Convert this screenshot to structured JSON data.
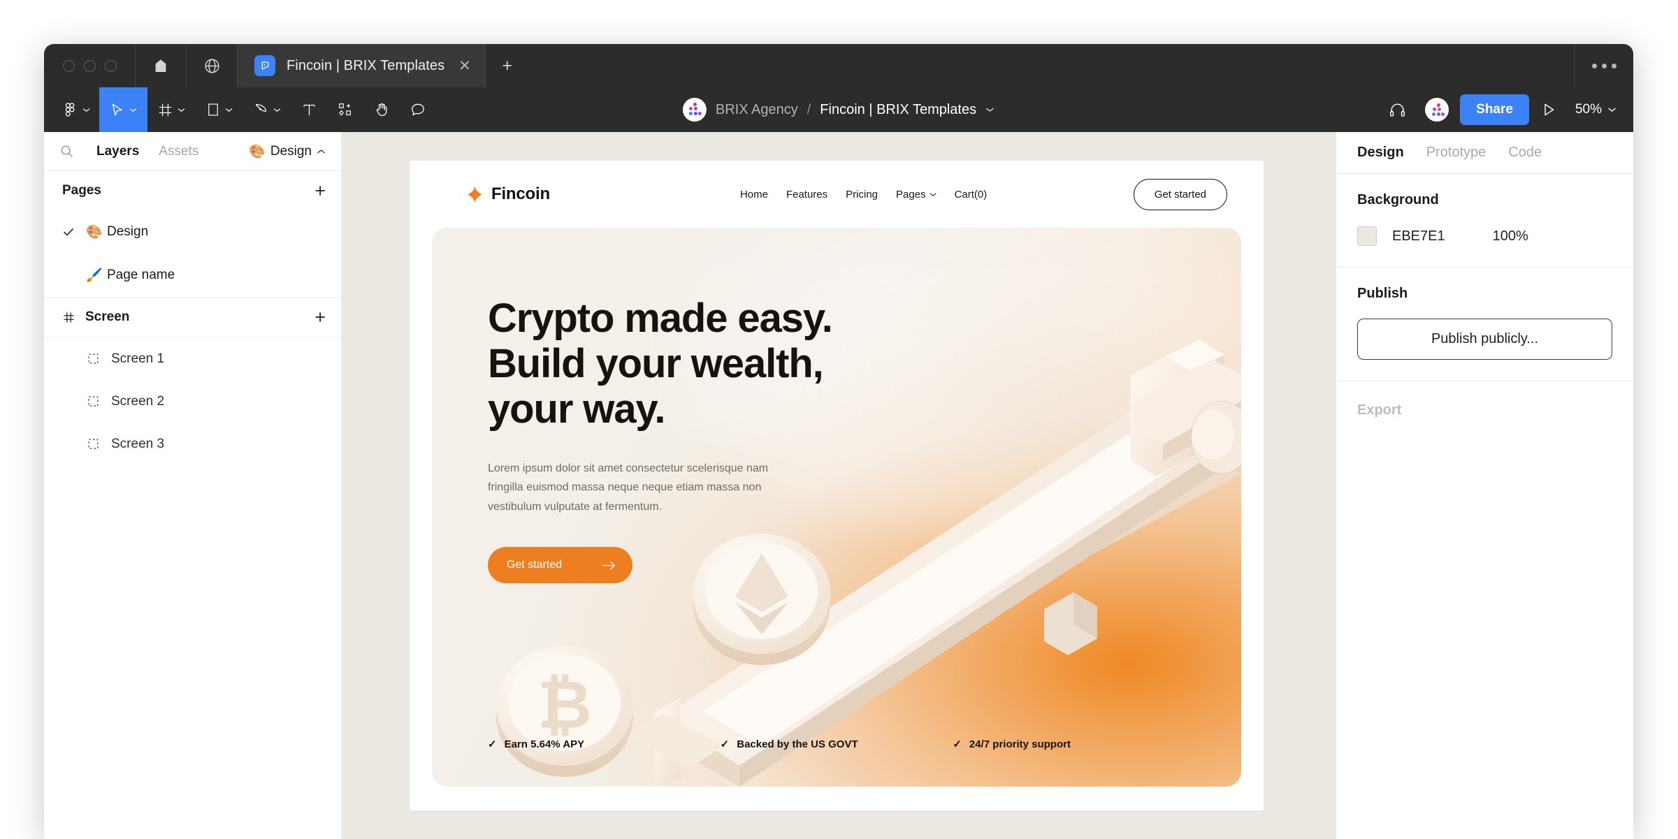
{
  "window": {
    "tab": {
      "title": "Fincoin | BRIX Templates",
      "close_label": "✕",
      "icon": "figma-file-icon"
    },
    "new_tab_label": "+",
    "home_icon": "home-icon",
    "globe_icon": "globe-icon",
    "more_menu": "window-more-menu"
  },
  "toolbar": {
    "tools": [
      {
        "name": "figma-menu",
        "icon": "figma-logo-icon",
        "caret": true,
        "active": false
      },
      {
        "name": "move-tool",
        "icon": "cursor-icon",
        "caret": true,
        "active": true
      },
      {
        "name": "frame-tool",
        "icon": "frame-icon",
        "caret": true,
        "active": false
      },
      {
        "name": "shape-tool",
        "icon": "rectangle-icon",
        "caret": true,
        "active": false
      },
      {
        "name": "pen-tool",
        "icon": "pen-icon",
        "caret": true,
        "active": false
      },
      {
        "name": "text-tool",
        "icon": "text-icon",
        "caret": false,
        "active": false
      },
      {
        "name": "resources-tool",
        "icon": "components-icon",
        "caret": false,
        "active": false
      },
      {
        "name": "hand-tool",
        "icon": "hand-icon",
        "caret": false,
        "active": false
      },
      {
        "name": "comment-tool",
        "icon": "comment-icon",
        "caret": false,
        "active": false
      }
    ],
    "breadcrumb": {
      "team": "BRIX Agency",
      "separator": "/",
      "file": "Fincoin | BRIX Templates",
      "caret_icon": "chevron-down-icon",
      "avatar": "brix-agency-avatar"
    },
    "headset_icon": "headset-icon",
    "user_avatar": "user-avatar",
    "share_label": "Share",
    "present_icon": "play-icon",
    "zoom_label": "50%",
    "accent_blue": "#3b82f6"
  },
  "left_panel": {
    "search_icon": "search-icon",
    "tabs": [
      {
        "label": "Layers",
        "active": true
      },
      {
        "label": "Assets",
        "active": false
      }
    ],
    "design_chip": {
      "emoji": "🎨",
      "label": "Design",
      "caret_icon": "chevron-up-icon"
    },
    "pages": {
      "title": "Pages",
      "add_label": "+",
      "items": [
        {
          "emoji": "🎨",
          "label": "Design",
          "selected": true
        },
        {
          "emoji": "🖌️",
          "label": "Page name",
          "selected": false
        }
      ]
    },
    "screen": {
      "title": "Screen",
      "hash_icon": "frame-hash-icon",
      "add_label": "+",
      "layers": [
        {
          "icon": "frame-icon",
          "label": "Screen 1"
        },
        {
          "icon": "frame-icon",
          "label": "Screen 2"
        },
        {
          "icon": "frame-icon",
          "label": "Screen 3"
        }
      ]
    }
  },
  "right_panel": {
    "tabs": [
      {
        "label": "Design",
        "active": true
      },
      {
        "label": "Prototype",
        "active": false
      },
      {
        "label": "Code",
        "active": false
      }
    ],
    "background": {
      "title": "Background",
      "hex": "EBE7E1",
      "color": "#EBE7E1",
      "opacity": "100%"
    },
    "publish": {
      "title": "Publish",
      "button_label": "Publish publicly..."
    },
    "export": {
      "title": "Export"
    }
  },
  "canvas": {
    "background_color": "#EBE7E1",
    "site": {
      "nav": {
        "logo_text": "Fincoin",
        "logo_icon": "fincoin-diamond-icon",
        "logo_color": "#ED7F20",
        "menu": [
          {
            "label": "Home",
            "caret": false
          },
          {
            "label": "Features",
            "caret": false
          },
          {
            "label": "Pricing",
            "caret": false
          },
          {
            "label": "Pages",
            "caret": true
          },
          {
            "label": "Cart(0)",
            "caret": false
          }
        ],
        "cta_label": "Get started"
      },
      "hero": {
        "title": "Crypto made easy. Build your wealth, your way.",
        "subtitle": "Lorem ipsum dolor sit amet consectetur scelerisque nam fringilla euismod massa neque neque etiam massa non vestibulum vulputate at fermentum.",
        "cta_label": "Get started",
        "cta_arrow": "arrow-right-icon",
        "cta_color": "#ED7F20",
        "features": [
          {
            "check": "✓",
            "label": "Earn 5.64% APY"
          },
          {
            "check": "✓",
            "label": "Backed by the US GOVT"
          },
          {
            "check": "✓",
            "label": "24/7 priority support"
          }
        ],
        "illustration": "conveyor-belt-with-bitcoin-and-ethereum-coins-3d"
      }
    }
  }
}
